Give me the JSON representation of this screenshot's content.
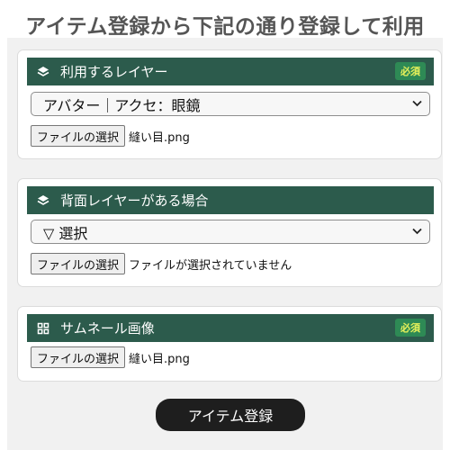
{
  "page": {
    "title": "アイテム登録から下記の通り登録して利用"
  },
  "sections": [
    {
      "header_icon": "layers-icon",
      "header_label": "利用するレイヤー",
      "badge": "必須",
      "select_value": "アバター｜アクセ：眼鏡",
      "file_button": "ファイルの選択",
      "file_name": "縫い目.png"
    },
    {
      "header_icon": "layers-icon",
      "header_label": "背面レイヤーがある場合",
      "select_value": "▽ 選択",
      "file_button": "ファイルの選択",
      "file_name": "ファイルが選択されていません"
    },
    {
      "header_icon": "grid-icon",
      "header_label": "サムネール画像",
      "badge": "必須",
      "file_button": "ファイルの選択",
      "file_name": "縫い目.png"
    }
  ],
  "submit_label": "アイテム登録",
  "colors": {
    "header_bg": "#2c5b4c",
    "badge_bg": "#2e8a55",
    "badge_text": "#e9f25a",
    "submit_bg": "#1e1e1e",
    "panel_bg": "#f1f1f1"
  }
}
